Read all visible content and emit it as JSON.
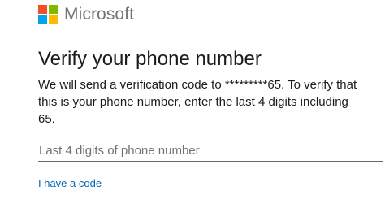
{
  "brand": {
    "name": "Microsoft",
    "logo_colors": [
      "#f25022",
      "#7fba00",
      "#00a4ef",
      "#ffb900"
    ]
  },
  "page": {
    "title": "Verify your phone number",
    "description_lines": [
      "We will send a verification code to *********65. To verify that",
      "this is your phone number, enter the last 4 digits including",
      "65."
    ]
  },
  "form": {
    "phone_input": {
      "placeholder": "Last 4 digits of phone number",
      "value": ""
    }
  },
  "links": {
    "have_code": "I have a code"
  },
  "colors": {
    "link": "#0067b8",
    "text": "#1b1b1b",
    "brand_text": "#737373"
  }
}
